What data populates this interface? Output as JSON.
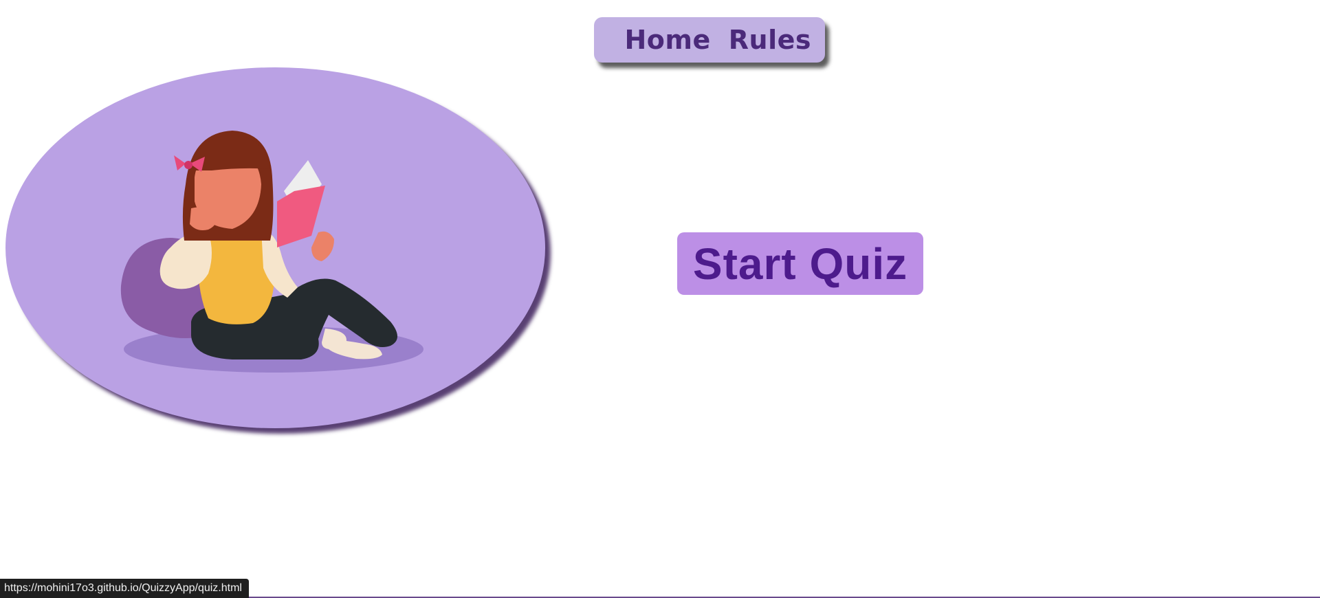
{
  "nav": {
    "items": [
      {
        "label": "Home"
      },
      {
        "label": "Rules"
      }
    ]
  },
  "hero": {
    "illustration": "girl-reading-book-illustration"
  },
  "cta": {
    "label": "Start Quiz"
  },
  "status_bar": {
    "url": "https://mohini17o3.github.io/QuizzyApp/quiz.html"
  },
  "colors": {
    "nav_bg": "#c1b1e3",
    "nav_text": "#4b2a7a",
    "ellipse_bg": "#baa1e4",
    "cta_bg": "#bc8fe6",
    "cta_text": "#4d1b8c"
  }
}
